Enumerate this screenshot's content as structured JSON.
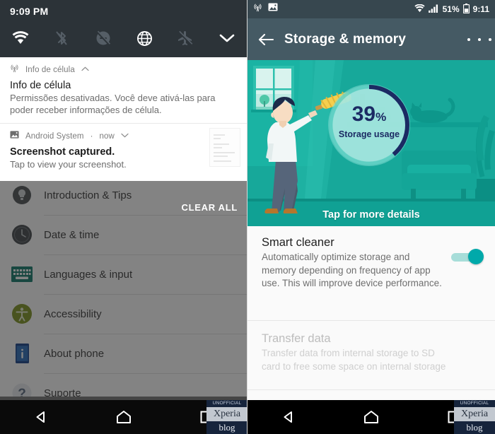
{
  "left_panel": {
    "status": {
      "time": "9:09 PM"
    },
    "quick_settings": {
      "tiles": [
        {
          "name": "wifi-icon",
          "state": "on"
        },
        {
          "name": "bluetooth-off-icon",
          "state": "off"
        },
        {
          "name": "do-not-disturb-off-icon",
          "state": "off"
        },
        {
          "name": "mobile-data-icon",
          "state": "on"
        },
        {
          "name": "airplane-mode-off-icon",
          "state": "off"
        },
        {
          "name": "chevron-down-icon",
          "state": "on"
        }
      ]
    },
    "notifications": [
      {
        "app": "Info de célula",
        "app_icon": "cell-tower-icon",
        "expand_icon": "chevron-up-icon",
        "title": "Info de célula",
        "body": "Permissões desativadas. Você deve ativá-las para poder receber informações de célula."
      },
      {
        "app": "Android System",
        "time": "now",
        "separator": "·",
        "app_icon": "image-icon",
        "expand_icon": "chevron-down-icon",
        "title": "Screenshot captured.",
        "body": "Tap to view your screenshot.",
        "thumbnail": "screenshot-thumbnail"
      }
    ],
    "clear_all_label": "CLEAR ALL",
    "settings_list": [
      {
        "label": "Introduction & Tips",
        "icon": "tips-icon",
        "color": "#4e5256"
      },
      {
        "label": "Date & time",
        "icon": "clock-icon",
        "color": "#43484c"
      },
      {
        "label": "Languages & input",
        "icon": "keyboard-icon",
        "color": "#127a6b"
      },
      {
        "label": "Accessibility",
        "icon": "accessibility-icon",
        "color": "#7f9423"
      },
      {
        "label": "About phone",
        "icon": "about-phone-icon",
        "color": "#2a6ebb"
      },
      {
        "label": "Suporte",
        "icon": "help-icon",
        "color": "#9aa1a8"
      }
    ],
    "navbar": [
      {
        "name": "back-button",
        "icon": "triangle-left-icon"
      },
      {
        "name": "home-button",
        "icon": "home-icon"
      },
      {
        "name": "recents-button",
        "icon": "square-icon"
      }
    ],
    "watermark": {
      "top": "UNOFFICIAL",
      "mid": "Xperia",
      "bot": "blog"
    }
  },
  "right_panel": {
    "status": {
      "left_icons": [
        {
          "name": "cell-tower-icon"
        },
        {
          "name": "image-icon"
        }
      ],
      "wifi_icon": "wifi-icon",
      "signal_icon": "signal-bars-icon",
      "battery_percent": "51%",
      "battery_icon": "battery-icon",
      "time": "9:11"
    },
    "appbar": {
      "back_icon": "arrow-left-icon",
      "title": "Storage & memory",
      "overflow_icon": "more-vertical-icon"
    },
    "hero": {
      "illustration": "person-dusting-living-room-illustration",
      "tap_label": "Tap for more details",
      "gauge": {
        "percent_value": "39",
        "percent_symbol": "%",
        "label": "Storage usage",
        "arc_color": "#1b2a63",
        "dial_color": "#8fe0d8"
      },
      "background_color": "#17a89a"
    },
    "items": [
      {
        "title": "Smart cleaner",
        "subtitle": "Automatically optimize storage and memory depending on frequency of app use. This will improve device performance.",
        "toggle": {
          "name": "smart-cleaner-toggle",
          "state": "on",
          "color": "#00a9aa"
        },
        "enabled": true
      },
      {
        "title": "Transfer data",
        "subtitle": "Transfer data from internal storage to SD card to free some space on internal storage",
        "enabled": false
      }
    ],
    "navbar": [
      {
        "name": "back-button",
        "icon": "triangle-left-icon"
      },
      {
        "name": "home-button",
        "icon": "home-icon"
      },
      {
        "name": "recents-button",
        "icon": "square-icon"
      }
    ],
    "watermark": {
      "top": "UNOFFICIAL",
      "mid": "Xperia",
      "bot": "blog"
    }
  }
}
